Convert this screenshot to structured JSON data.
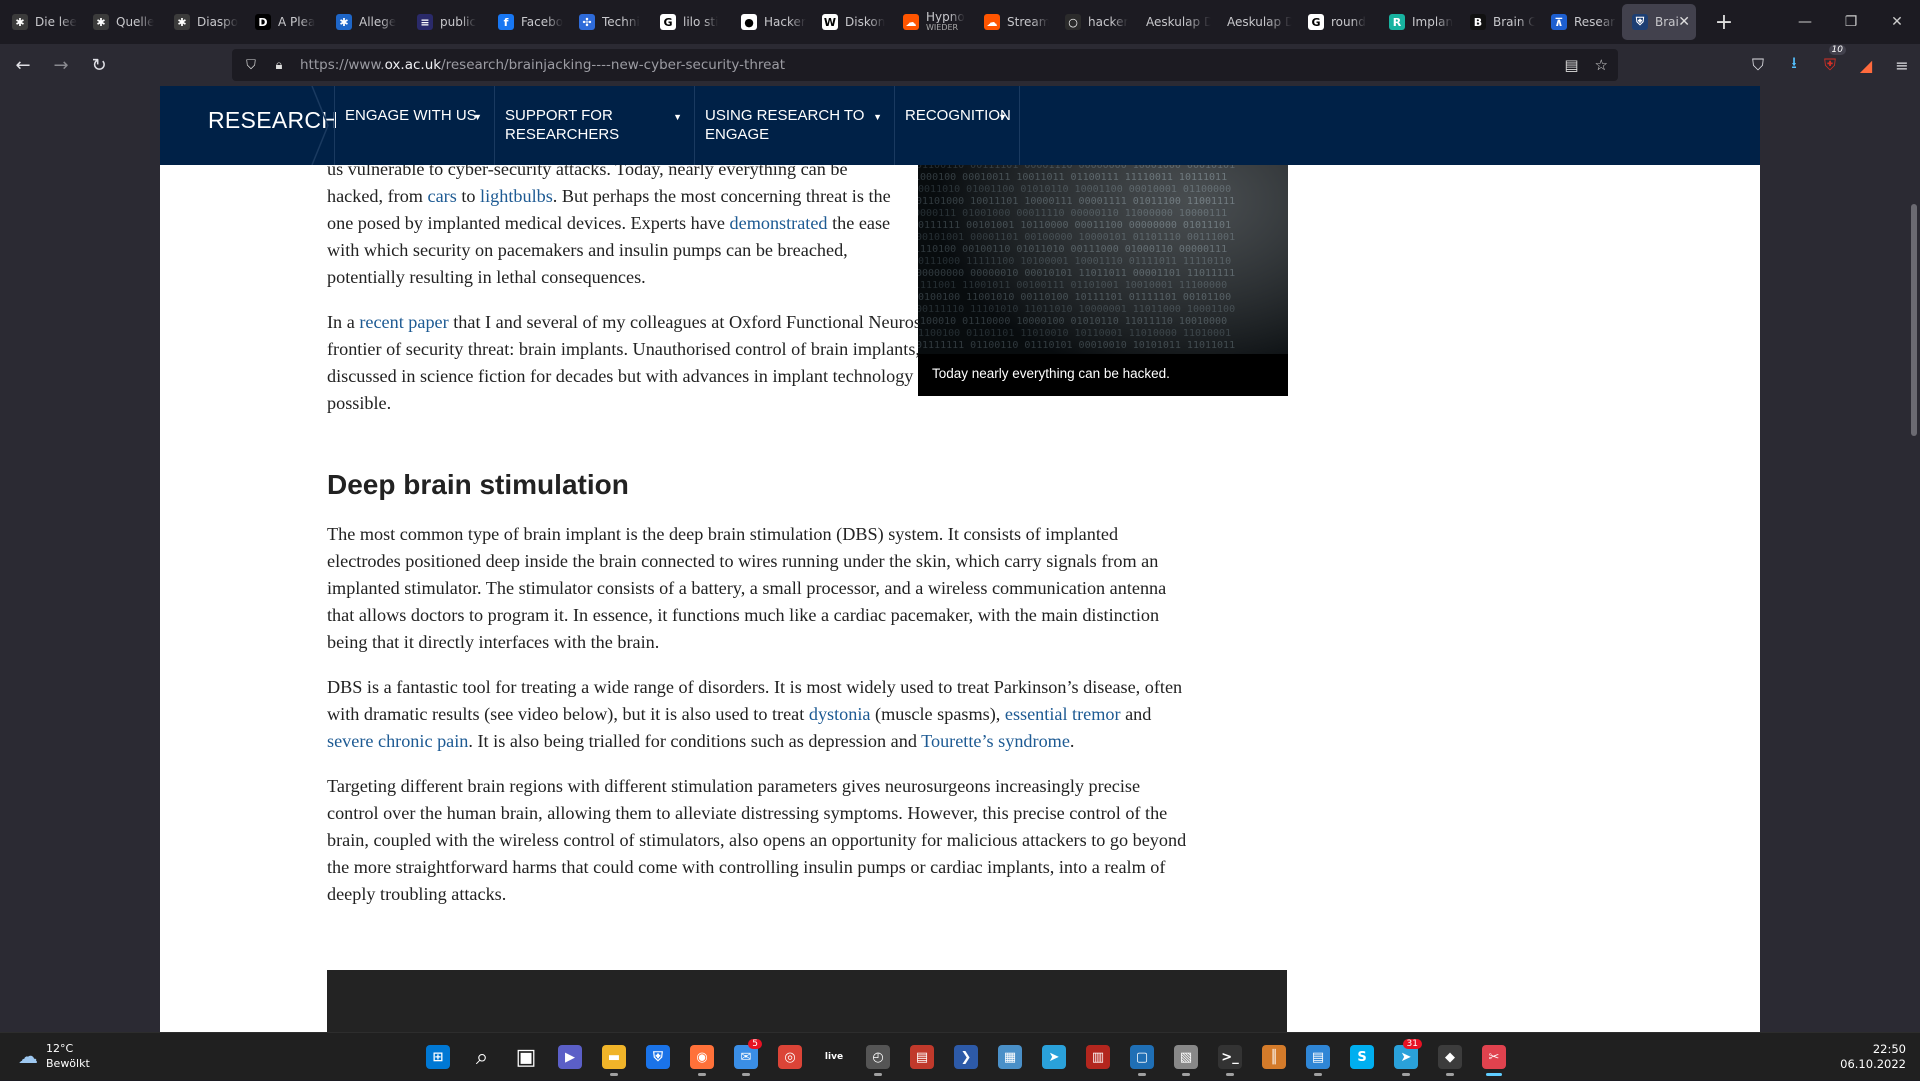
{
  "browser": {
    "tabs": [
      {
        "label": "Die lee",
        "icon": "asterisk-icon",
        "color": "#3b3b3b",
        "glyph": "✱"
      },
      {
        "label": "Quelle",
        "icon": "asterisk-icon",
        "color": "#3b3b3b",
        "glyph": "✱"
      },
      {
        "label": "Diaspo",
        "icon": "asterisk-icon",
        "color": "#3b3b3b",
        "glyph": "✱"
      },
      {
        "label": "A Plea",
        "icon": "d-logo-icon",
        "color": "#000000",
        "glyph": "D"
      },
      {
        "label": "Allege",
        "icon": "asterisk-icon",
        "color": "#1e66c8",
        "glyph": "✱"
      },
      {
        "label": "public",
        "icon": "list-icon",
        "color": "#2a2a6a",
        "glyph": "≡"
      },
      {
        "label": "Facebo",
        "icon": "facebook-icon",
        "color": "#1877f2",
        "glyph": "f"
      },
      {
        "label": "Techni",
        "icon": "network-icon",
        "color": "#2e6bd9",
        "glyph": "✣"
      },
      {
        "label": "lilo sti",
        "icon": "google-icon",
        "color": "#ffffff",
        "glyph": "G"
      },
      {
        "label": "Hacker",
        "icon": "github-icon",
        "color": "#ffffff",
        "glyph": "●"
      },
      {
        "label": "Diskon",
        "icon": "w-logo-icon",
        "color": "#ffffff",
        "glyph": "W"
      },
      {
        "label": "Hypno",
        "sub": "WIEDER",
        "icon": "soundcloud-icon",
        "color": "#ff5500",
        "glyph": "☁"
      },
      {
        "label": "Stream",
        "icon": "soundcloud-icon",
        "color": "#ff5500",
        "glyph": "☁"
      },
      {
        "label": "hacker",
        "icon": "github-icon",
        "color": "#2b2b2b",
        "glyph": "○"
      },
      {
        "label": "Aeskulap D",
        "icon": "none",
        "color": "transparent",
        "glyph": ""
      },
      {
        "label": "Aeskulap D",
        "icon": "none",
        "color": "transparent",
        "glyph": ""
      },
      {
        "label": "round",
        "icon": "google-icon",
        "color": "#ffffff",
        "glyph": "G"
      },
      {
        "label": "Implan",
        "icon": "r-logo-icon",
        "color": "#18b3a0",
        "glyph": "R"
      },
      {
        "label": "Brain C",
        "icon": "b-logo-icon",
        "color": "#111111",
        "glyph": "B"
      },
      {
        "label": "Researc",
        "icon": "research-icon",
        "color": "#1d5fd0",
        "glyph": "⊼"
      },
      {
        "label": "Brain",
        "icon": "oxford-shield-icon",
        "color": "#1d3f73",
        "glyph": "⛨",
        "active": true
      }
    ],
    "url_prefix": "https://www.",
    "url_domain": "ox.ac.uk",
    "url_path": "/research/brainjacking----new-cyber-security-threat",
    "extension_badge": "10"
  },
  "site": {
    "brand": "RESEARCH",
    "nav": [
      {
        "label": "ENGAGE WITH US"
      },
      {
        "label": "SUPPORT FOR RESEARCHERS"
      },
      {
        "label": "USING RESEARCH TO ENGAGE"
      },
      {
        "label": "RECOGNITION"
      }
    ]
  },
  "article": {
    "p0_a": "us vulnerable to cyber-security attacks. Today, nearly everything can be hacked, from ",
    "p0_link1": "cars",
    "p0_b": " to ",
    "p0_link2": "lightbulbs",
    "p0_c": ". But perhaps the most concerning threat is the one posed by implanted medical devices. Experts have ",
    "p0_link3": "demonstrated",
    "p0_d": " the ease with which security on pacemakers and insulin pumps can be breached, potentially resulting in lethal consequences.",
    "p1_a": "In a ",
    "p1_link": "recent paper",
    "p1_b": " that I and several of my colleagues at Oxford Functional Neurosurgery wrote, we discussed a new frontier of security threat: brain implants. Unauthorised control of brain implants, or “brainjacking”, has been discussed in science fiction for decades but with advances in implant technology it is now starting to become possible.",
    "heading": "Deep brain stimulation",
    "p2": "The most common type of brain implant is the deep brain stimulation (DBS) system. It consists of implanted electrodes positioned deep inside the brain connected to wires running under the skin, which carry signals from an implanted stimulator. The stimulator consists of a battery, a small processor, and a wireless communication antenna that allows doctors to program it. In essence, it functions much like a cardiac pacemaker, with the main distinction being that it directly interfaces with the brain.",
    "p3_a": "DBS is a fantastic tool for treating a wide range of disorders. It is most widely used to treat Parkinson’s disease, often with dramatic results (see video below), but it is also used to treat ",
    "p3_link1": "dystonia",
    "p3_b": " (muscle spasms), ",
    "p3_link2": "essential tremor",
    "p3_c": " and ",
    "p3_link3": "severe chronic pain",
    "p3_d": ". It is also being trialled for conditions such as depression and ",
    "p3_link4": "Tourette’s syndrome",
    "p3_e": ".",
    "p4": "Targeting different brain regions with different stimulation parameters gives neurosurgeons increasingly precise control over the human brain, allowing them to alleviate distressing symptoms. However, this precise control of the brain, coupled with the wireless control of stimulators, also opens an opportunity for malicious attackers to go beyond the more straightforward harms that could come with controlling insulin pumps or cardiac implants, into a realm of deeply troubling attacks.",
    "image_caption": "Today nearly everything can be hacked."
  },
  "taskbar": {
    "temp": "12°C",
    "weather": "Bewölkt",
    "time": "22:50",
    "date": "06.10.2022",
    "apps": [
      {
        "name": "windows-start-icon",
        "color": "#0078d4",
        "glyph": "⊞"
      },
      {
        "name": "search-icon",
        "color": "transparent",
        "glyph": "⌕"
      },
      {
        "name": "task-view-icon",
        "color": "transparent",
        "glyph": "▣"
      },
      {
        "name": "teams-chat-icon",
        "color": "#5b5fc7",
        "glyph": "▶"
      },
      {
        "name": "file-explorer-icon",
        "color": "#f0b429",
        "glyph": "▬",
        "running": true
      },
      {
        "name": "defender-icon",
        "color": "#1a73e8",
        "glyph": "⛨"
      },
      {
        "name": "firefox-icon",
        "color": "#ff7139",
        "glyph": "◉",
        "running": true
      },
      {
        "name": "mail-icon",
        "color": "#3a8ee6",
        "glyph": "✉",
        "badge": "5",
        "running": true
      },
      {
        "name": "chrome-icon",
        "color": "#db4437",
        "glyph": "◎"
      },
      {
        "name": "live-icon",
        "color": "#202020",
        "glyph": "live"
      },
      {
        "name": "clock-app-icon",
        "color": "#555555",
        "glyph": "◴",
        "running": true
      },
      {
        "name": "mixer-icon",
        "color": "#c0392b",
        "glyph": "▤"
      },
      {
        "name": "powershell-icon",
        "color": "#2d5aa8",
        "glyph": "❯"
      },
      {
        "name": "control-panel-icon",
        "color": "#4a90c8",
        "glyph": "▦"
      },
      {
        "name": "telegram-icon",
        "color": "#2aa1da",
        "glyph": "➤"
      },
      {
        "name": "voice-icon",
        "color": "#b3261e",
        "glyph": "▥"
      },
      {
        "name": "window-app-icon",
        "color": "#1f6fb5",
        "glyph": "▢",
        "running": true
      },
      {
        "name": "printer-icon",
        "color": "#888888",
        "glyph": "▧",
        "running": true
      },
      {
        "name": "terminal-icon",
        "color": "#333333",
        "glyph": ">_",
        "running": true
      },
      {
        "name": "library-icon",
        "color": "#d47b2a",
        "glyph": "║"
      },
      {
        "name": "notes-icon",
        "color": "#2f86d6",
        "glyph": "▤",
        "running": true
      },
      {
        "name": "skype-icon",
        "color": "#00aff0",
        "glyph": "S"
      },
      {
        "name": "telegram-icon",
        "color": "#2aa1da",
        "glyph": "➤",
        "badge": "31",
        "running": true
      },
      {
        "name": "vpn-icon",
        "color": "#3c3c3c",
        "glyph": "◆",
        "running": true
      },
      {
        "name": "snipping-tool-icon",
        "color": "#e0424e",
        "glyph": "✂",
        "running": true,
        "active": true
      }
    ]
  }
}
